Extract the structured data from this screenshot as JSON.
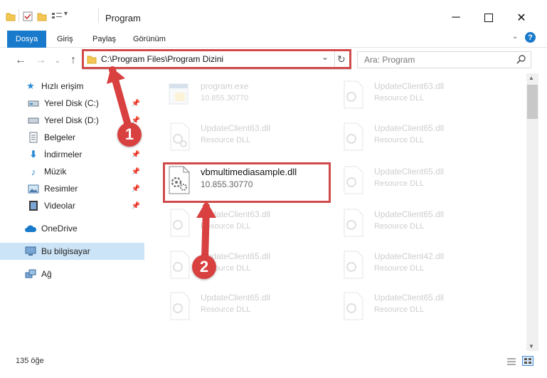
{
  "window": {
    "title": "Program",
    "minimize_icon": "minimize-icon",
    "maximize_icon": "maximize-icon",
    "close_icon": "close-icon"
  },
  "ribbon": {
    "tabs": [
      {
        "label": "Dosya",
        "active": true
      },
      {
        "label": "Giriş"
      },
      {
        "label": "Paylaş"
      },
      {
        "label": "Görünüm"
      }
    ]
  },
  "address": {
    "path": "C:\\Program Files\\Program Dizini"
  },
  "search": {
    "placeholder": "Ara: Program"
  },
  "sidebar": {
    "quick_access": "Hızlı erişim",
    "items": [
      {
        "label": "Yerel Disk (C:)",
        "icon": "drive-icon",
        "pinned": true
      },
      {
        "label": "Yerel Disk (D:)",
        "icon": "drive-icon",
        "pinned": true
      },
      {
        "label": "Belgeler",
        "icon": "documents-icon",
        "pinned": true
      },
      {
        "label": "İndirmeler",
        "icon": "download-icon",
        "pinned": true
      },
      {
        "label": "Müzik",
        "icon": "music-icon",
        "pinned": true
      },
      {
        "label": "Resimler",
        "icon": "pictures-icon",
        "pinned": true
      },
      {
        "label": "Videolar",
        "icon": "videos-icon",
        "pinned": true
      }
    ],
    "onedrive": "OneDrive",
    "this_pc": "Bu bilgisayar",
    "network": "Ağ"
  },
  "files": {
    "left": [
      {
        "name": "program.exe",
        "sub": "10.855.30770"
      },
      {
        "name": "UpdateClient63.dll",
        "sub": "Resource DLL"
      },
      {
        "name": "vbmultimediasample.dll",
        "sub": "10.855.30770"
      },
      {
        "name": "UpdateClient63.dll",
        "sub": "Resource DLL"
      },
      {
        "name": "UpdateClient65.dll",
        "sub": "Resource DLL"
      },
      {
        "name": "UpdateClient65.dll",
        "sub": "Resource DLL"
      }
    ],
    "right": [
      {
        "name": "UpdateClient63.dll",
        "sub": "Resource DLL"
      },
      {
        "name": "UpdateClient65.dll",
        "sub": "Resource DLL"
      },
      {
        "name": "UpdateClient65.dll",
        "sub": "Resource DLL"
      },
      {
        "name": "UpdateClient65.dll",
        "sub": "Resource DLL"
      },
      {
        "name": "UpdateClient42.dll",
        "sub": "Resource DLL"
      },
      {
        "name": "UpdateClient65.dll",
        "sub": "Resource DLL"
      }
    ]
  },
  "status": {
    "count": "135 öğe"
  },
  "annotations": {
    "step1": "1",
    "step2": "2",
    "highlight_color": "#d14a4a"
  }
}
